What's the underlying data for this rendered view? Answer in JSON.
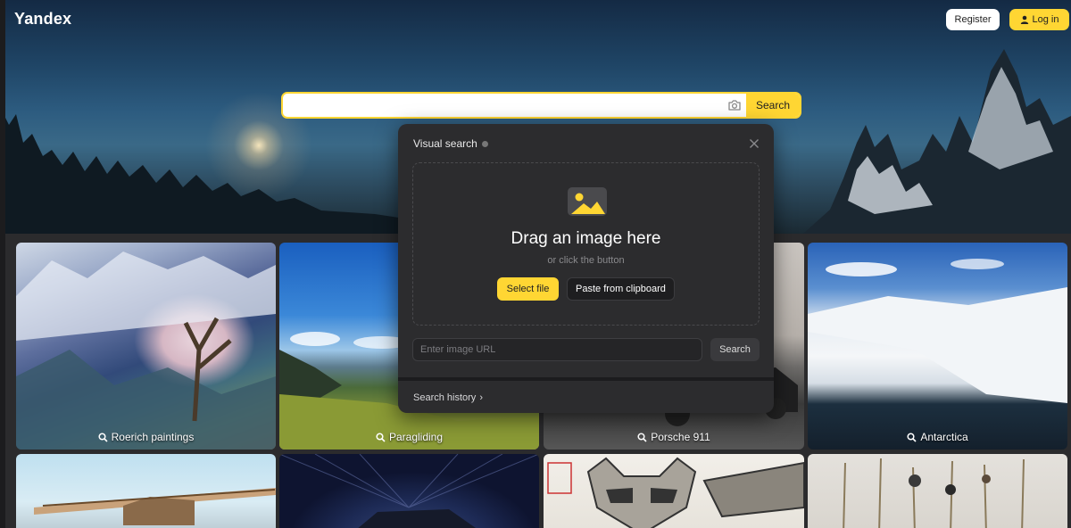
{
  "header": {
    "logo": "Yandex",
    "register_label": "Register",
    "login_label": "Log in"
  },
  "search": {
    "value": "",
    "placeholder": "",
    "button_label": "Search"
  },
  "visual_search": {
    "title": "Visual search",
    "drag_text": "Drag an image here",
    "or_text": "or click the button",
    "select_file_label": "Select file",
    "paste_label": "Paste from clipboard",
    "url_placeholder": "Enter image URL",
    "url_search_label": "Search",
    "history_label": "Search history",
    "history_chevron": "›"
  },
  "tiles": [
    {
      "caption": "Roerich paintings"
    },
    {
      "caption": "Paragliding"
    },
    {
      "caption": "Porsche 911"
    },
    {
      "caption": "Antarctica"
    }
  ],
  "colors": {
    "accent": "#ffd633",
    "popup_bg": "#2c2c2e",
    "page_bg": "#2b2b2d"
  },
  "icons": {
    "camera": "camera-icon",
    "close": "close-icon",
    "image": "image-icon",
    "search": "search-icon",
    "user": "user-icon"
  }
}
